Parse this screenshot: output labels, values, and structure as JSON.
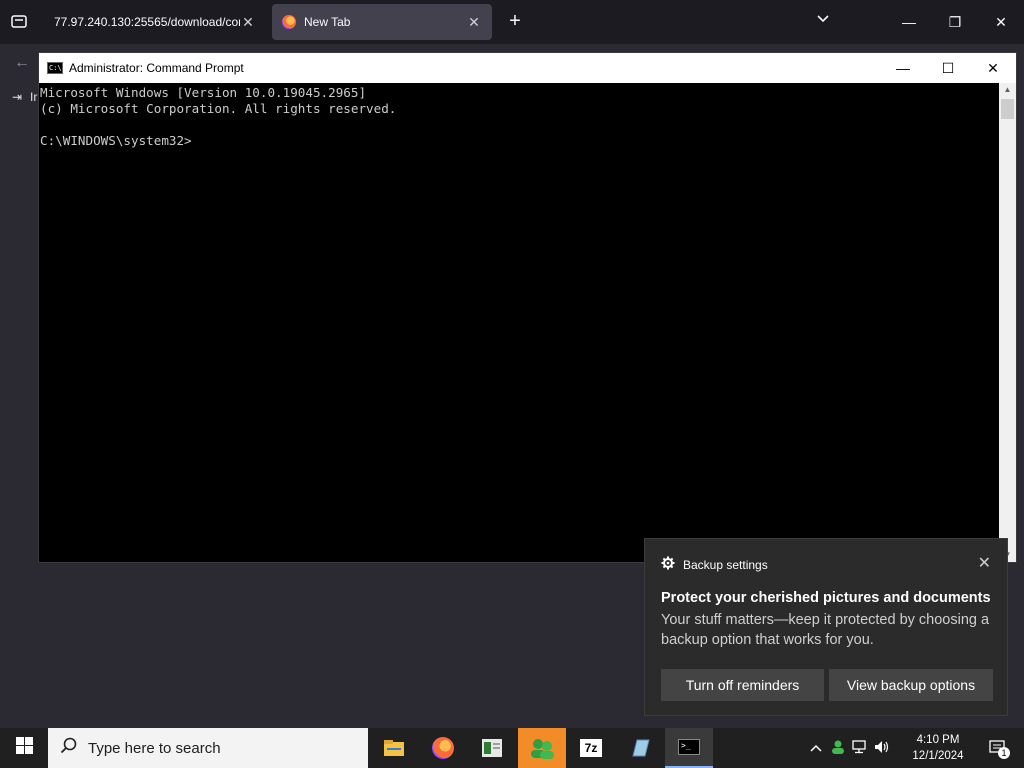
{
  "browser": {
    "tabs": [
      {
        "label": "77.97.240.130:25565/download/cor",
        "active": false
      },
      {
        "label": "New Tab",
        "active": true
      }
    ],
    "new_tab_glyph": "+",
    "sidebar_label": "Ir"
  },
  "cmd": {
    "title": "Administrator: Command Prompt",
    "lines": [
      "Microsoft Windows [Version 10.0.19045.2965]",
      "(c) Microsoft Corporation. All rights reserved.",
      "",
      "C:\\WINDOWS\\system32>"
    ]
  },
  "toast": {
    "app": "Backup settings",
    "title": "Protect your cherished pictures and documents",
    "body": "Your stuff matters—keep it protected by choosing a backup option that works for you.",
    "button_off": "Turn off reminders",
    "button_view": "View backup options"
  },
  "taskbar": {
    "search_placeholder": "Type here to search",
    "apps": [
      "file-explorer-icon",
      "firefox-icon",
      "notepad-icon",
      "people-icon",
      "7zip-icon",
      "editor-icon",
      "cmd-icon"
    ],
    "time": "4:10 PM",
    "date": "12/1/2024",
    "notification_count": "1"
  }
}
